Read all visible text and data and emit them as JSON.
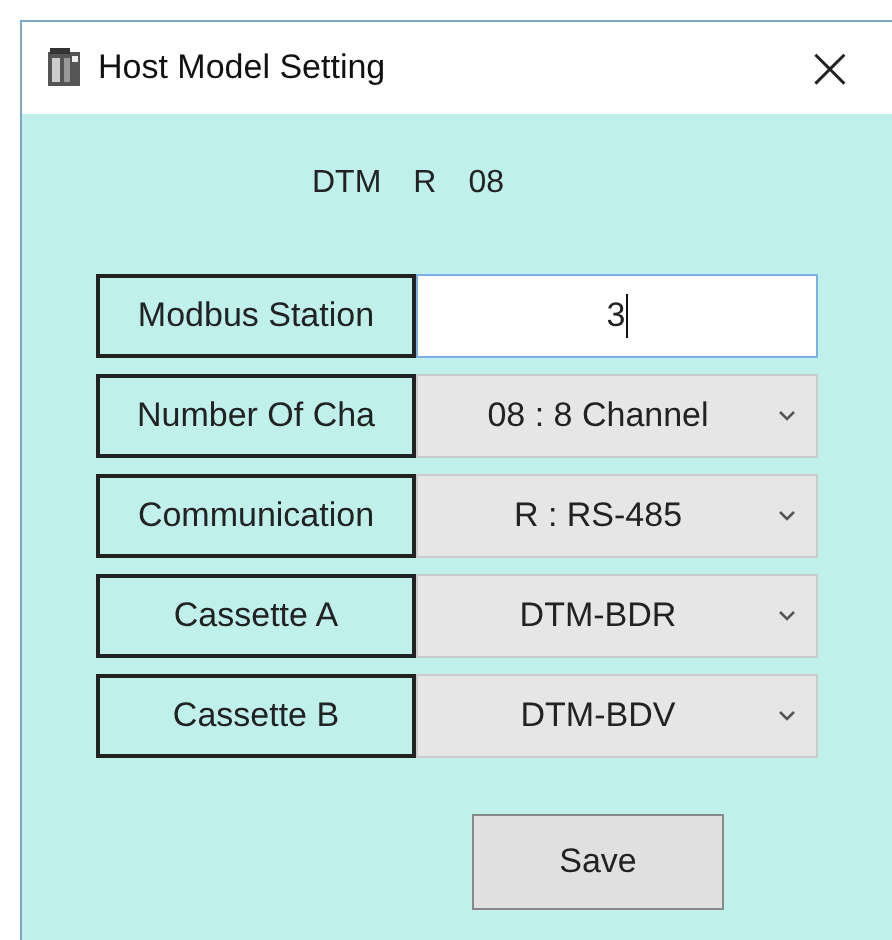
{
  "window": {
    "title": "Host Model Setting",
    "close": "×"
  },
  "model_code": [
    "DTM",
    "R",
    "08"
  ],
  "fields": [
    {
      "kind": "input",
      "label": "Modbus Station",
      "value": "3",
      "focused": true
    },
    {
      "kind": "select",
      "label": "Number Of Cha",
      "value": "08 : 8 Channel"
    },
    {
      "kind": "select",
      "label": "Communication",
      "value": "R : RS-485"
    },
    {
      "kind": "select",
      "label": "Cassette A",
      "value": "DTM-BDR"
    },
    {
      "kind": "select",
      "label": "Cassette B",
      "value": "DTM-BDV"
    }
  ],
  "buttons": [
    "Save"
  ]
}
